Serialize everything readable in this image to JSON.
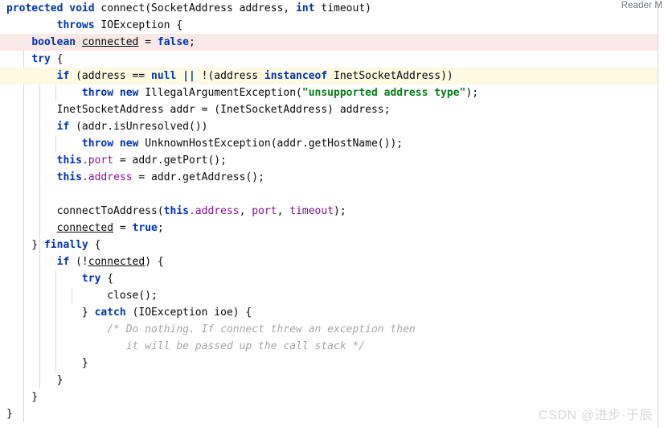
{
  "editor": {
    "reader_mode_label": "Reader M",
    "watermark": "CSDN @进步·于辰",
    "colors": {
      "background": "#ffffff",
      "keyword": "#0033b3",
      "string": "#067d17",
      "field": "#871094",
      "comment": "#aaa3ab",
      "text": "#080808",
      "highlight_pink": "#f8e9e7",
      "highlight_yellow": "#fdfae4",
      "indent_guide": "#d8d8d8",
      "border": "#d6d6d6",
      "watermark": "#d8d8d8"
    },
    "lines": [
      {
        "n": 1,
        "highlight": "none",
        "text": "protected void connect(SocketAddress address, int timeout)"
      },
      {
        "n": 2,
        "highlight": "none",
        "text": "        throws IOException {"
      },
      {
        "n": 3,
        "highlight": "pink",
        "text": "    boolean connected = false;"
      },
      {
        "n": 4,
        "highlight": "none",
        "text": "    try {"
      },
      {
        "n": 5,
        "highlight": "yellow",
        "text": "        if (address == null || !(address instanceof InetSocketAddress))"
      },
      {
        "n": 6,
        "highlight": "none",
        "text": "            throw new IllegalArgumentException(\"unsupported address type\");"
      },
      {
        "n": 7,
        "highlight": "none",
        "text": "        InetSocketAddress addr = (InetSocketAddress) address;"
      },
      {
        "n": 8,
        "highlight": "none",
        "text": "        if (addr.isUnresolved())"
      },
      {
        "n": 9,
        "highlight": "none",
        "text": "            throw new UnknownHostException(addr.getHostName());"
      },
      {
        "n": 10,
        "highlight": "none",
        "text": "        this.port = addr.getPort();"
      },
      {
        "n": 11,
        "highlight": "none",
        "text": "        this.address = addr.getAddress();"
      },
      {
        "n": 12,
        "highlight": "none",
        "text": ""
      },
      {
        "n": 13,
        "highlight": "none",
        "text": "        connectToAddress(this.address, port, timeout);"
      },
      {
        "n": 14,
        "highlight": "none",
        "text": "        connected = true;"
      },
      {
        "n": 15,
        "highlight": "none",
        "text": "    } finally {"
      },
      {
        "n": 16,
        "highlight": "none",
        "text": "        if (!connected) {"
      },
      {
        "n": 17,
        "highlight": "none",
        "text": "            try {"
      },
      {
        "n": 18,
        "highlight": "none",
        "text": "                close();"
      },
      {
        "n": 19,
        "highlight": "none",
        "text": "            } catch (IOException ioe) {"
      },
      {
        "n": 20,
        "highlight": "none",
        "text": "                /* Do nothing. If connect threw an exception then"
      },
      {
        "n": 21,
        "highlight": "none",
        "text": "                   it will be passed up the call stack */"
      },
      {
        "n": 22,
        "highlight": "none",
        "text": "            }"
      },
      {
        "n": 23,
        "highlight": "none",
        "text": "        }"
      },
      {
        "n": 24,
        "highlight": "none",
        "text": "    }"
      },
      {
        "n": 25,
        "highlight": "none",
        "text": "}"
      }
    ]
  }
}
